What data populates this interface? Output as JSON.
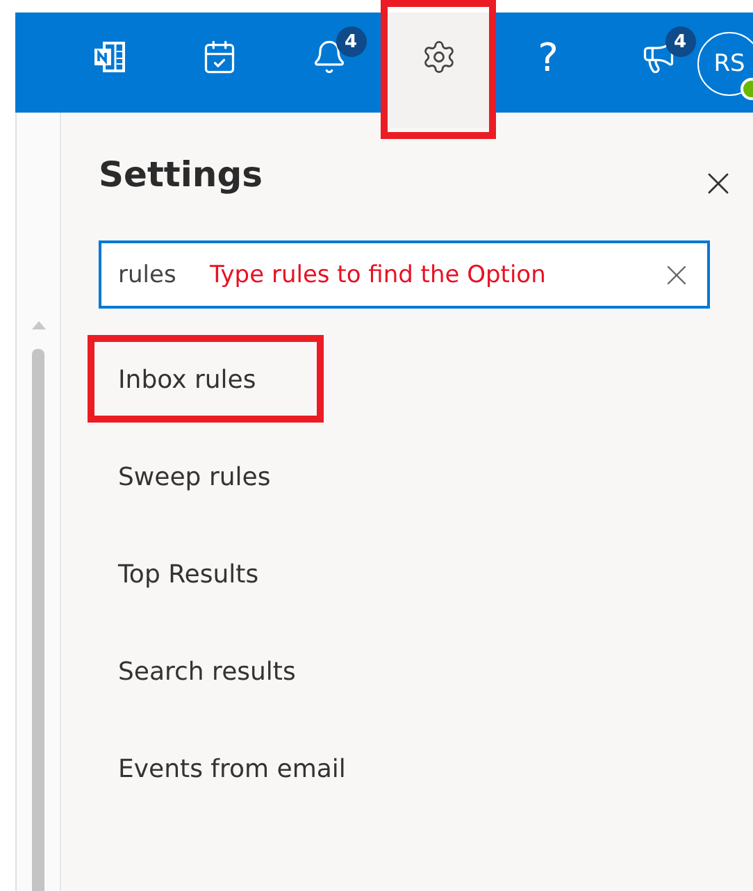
{
  "toolbar": {
    "items": [
      {
        "kind": "onenote",
        "highlighted": false
      },
      {
        "kind": "todo",
        "highlighted": false
      },
      {
        "kind": "bell",
        "badge": "4",
        "highlighted": false
      },
      {
        "kind": "settings",
        "selected": true,
        "highlighted": true
      },
      {
        "kind": "help",
        "glyph": "?",
        "highlighted": false
      },
      {
        "kind": "feedback",
        "badge": "4",
        "highlighted": false
      }
    ],
    "avatar": {
      "initials": "RS",
      "online": true
    }
  },
  "settings_panel": {
    "title": "Settings",
    "search": {
      "value": "rules",
      "annotation": "Type rules to find the Option"
    },
    "results": [
      {
        "label": "Inbox rules",
        "highlighted": true
      },
      {
        "label": "Sweep rules",
        "highlighted": false
      },
      {
        "label": "Top Results",
        "highlighted": false
      },
      {
        "label": "Search results",
        "highlighted": false
      },
      {
        "label": "Events from email",
        "highlighted": false
      }
    ]
  }
}
